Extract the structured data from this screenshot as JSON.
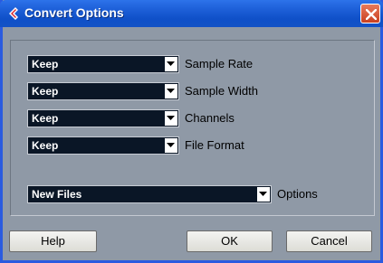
{
  "window": {
    "title": "Convert Options"
  },
  "icons": {
    "app": "cubase-logo-icon",
    "close": "close-icon",
    "dropdown": "chevron-down-icon"
  },
  "colors": {
    "titlebar": "#1d5fd8",
    "dialog_bg": "#8f99a6",
    "combo_bg": "#0a1626",
    "close": "#d85a32"
  },
  "options": [
    {
      "value": "Keep",
      "label": "Sample Rate"
    },
    {
      "value": "Keep",
      "label": "Sample Width"
    },
    {
      "value": "Keep",
      "label": "Channels"
    },
    {
      "value": "Keep",
      "label": "File Format"
    }
  ],
  "files": {
    "value": "New Files",
    "label": "Options"
  },
  "buttons": {
    "help": "Help",
    "ok": "OK",
    "cancel": "Cancel"
  }
}
